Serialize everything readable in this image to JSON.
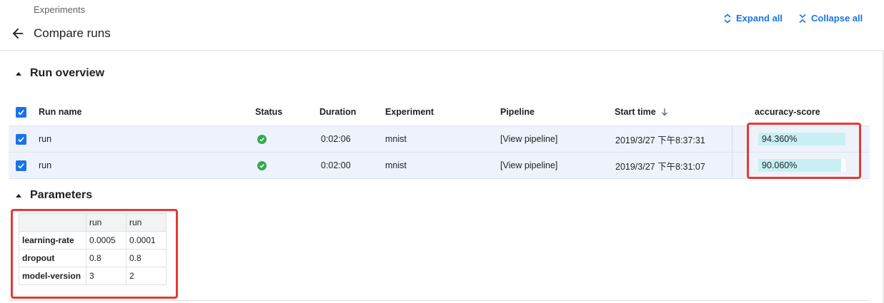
{
  "header": {
    "breadcrumb": "Experiments",
    "title": "Compare runs",
    "expand_all": "Expand all",
    "collapse_all": "Collapse all"
  },
  "run_overview": {
    "title": "Run overview",
    "columns": {
      "run_name": "Run name",
      "status": "Status",
      "duration": "Duration",
      "experiment": "Experiment",
      "pipeline": "Pipeline",
      "start_time": "Start time",
      "metric": "accuracy-score"
    },
    "rows": [
      {
        "name": "run",
        "status": "succeeded",
        "duration": "0:02:06",
        "experiment": "mnist",
        "pipeline": "[View pipeline]",
        "start_time": "2019/3/27 下午8:37:31",
        "metric_text": "94.360%",
        "metric_fraction": 1.0
      },
      {
        "name": "run",
        "status": "succeeded",
        "duration": "0:02:00",
        "experiment": "mnist",
        "pipeline": "[View pipeline]",
        "start_time": "2019/3/27 下午8:31:07",
        "metric_text": "90.060%",
        "metric_fraction": 0.95
      }
    ]
  },
  "parameters": {
    "title": "Parameters",
    "columns": [
      "run",
      "run"
    ],
    "rows": [
      {
        "key": "learning-rate",
        "values": [
          "0.0005",
          "0.0001"
        ]
      },
      {
        "key": "dropout",
        "values": [
          "0.8",
          "0.8"
        ]
      },
      {
        "key": "model-version",
        "values": [
          "3",
          "2"
        ]
      }
    ]
  },
  "colors": {
    "accent": "#1a73e8",
    "success": "#34a853",
    "metric_bar": "#c8f0f4",
    "row_selected": "#eef3fb",
    "annotation": "#e53935"
  },
  "icons": {
    "back": "arrow-left-icon",
    "expand": "unfold-more-icon",
    "collapse": "unfold-less-icon",
    "status": "check-circle-icon",
    "sort": "arrow-down-icon",
    "section": "triangle-up-icon"
  }
}
